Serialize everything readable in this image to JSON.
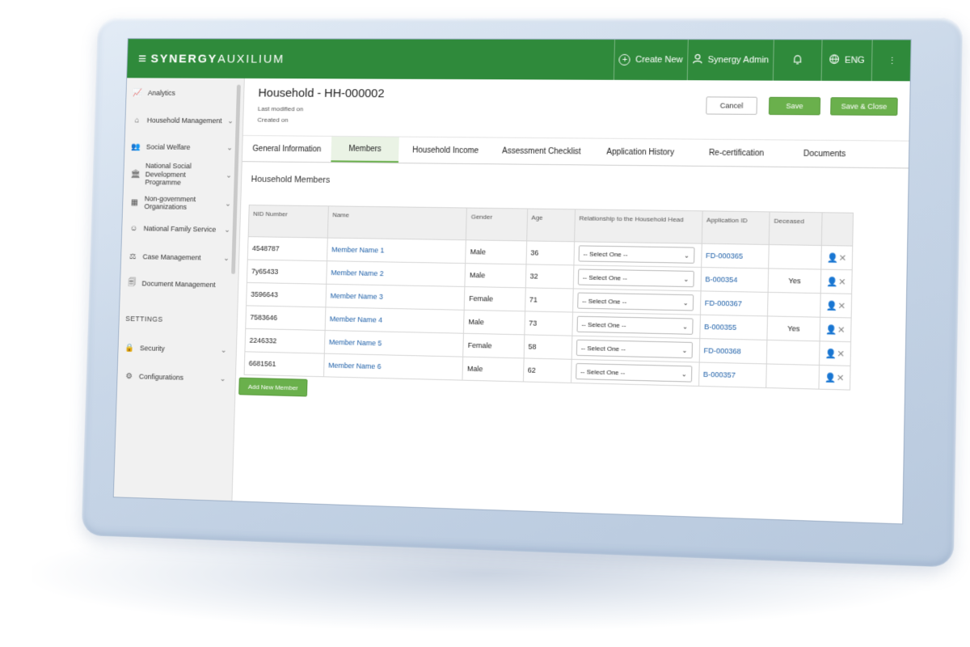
{
  "app": {
    "brand_strong": "SYNERGY",
    "brand_light": "AUXILIUM"
  },
  "topbar": {
    "create_new": "Create New",
    "user": "Synergy Admin",
    "language": "ENG"
  },
  "sidebar": {
    "items": [
      {
        "label": "Analytics",
        "icon": "chart-icon",
        "has_chevron": false
      },
      {
        "label": "Household Management",
        "icon": "home-icon",
        "has_chevron": true
      },
      {
        "label": "Social Welfare",
        "icon": "people-icon",
        "has_chevron": true
      },
      {
        "label": "National Social Development Programme",
        "icon": "bank-icon",
        "has_chevron": true
      },
      {
        "label": "Non-government Organizations",
        "icon": "building-icon",
        "has_chevron": true
      },
      {
        "label": "National Family Service",
        "icon": "family-icon",
        "has_chevron": true
      },
      {
        "label": "Case Management",
        "icon": "scale-icon",
        "has_chevron": true
      },
      {
        "label": "Document Management",
        "icon": "document-icon",
        "has_chevron": false
      }
    ],
    "settings_heading": "SETTINGS",
    "settings_items": [
      {
        "label": "Security",
        "icon": "lock-icon"
      },
      {
        "label": "Configurations",
        "icon": "gear-icon"
      }
    ]
  },
  "page": {
    "title": "Household - HH-000002",
    "last_modified": "Last modified on",
    "created": "Created on",
    "cancel": "Cancel",
    "save": "Save",
    "save_close": "Save & Close"
  },
  "tabs": [
    {
      "label": "General Information",
      "active": false
    },
    {
      "label": "Members",
      "active": true
    },
    {
      "label": "Household Income",
      "active": false
    },
    {
      "label": "Assessment Checklist",
      "active": false
    },
    {
      "label": "Application History",
      "active": false
    },
    {
      "label": "Re-certification",
      "active": false
    },
    {
      "label": "Documents",
      "active": false
    }
  ],
  "members": {
    "section_title": "Household Members",
    "columns": [
      "NID Number",
      "Name",
      "Gender",
      "Age",
      "Relationship to the Household Head",
      "Application ID",
      "Deceased",
      ""
    ],
    "select_placeholder": "-- Select One --",
    "rows": [
      {
        "nid": "4548787",
        "name": "Member Name 1",
        "gender": "Male",
        "age": "36",
        "app_id": "FD-000365",
        "deceased": ""
      },
      {
        "nid": "7y65433",
        "name": "Member Name 2",
        "gender": "Male",
        "age": "32",
        "app_id": "B-000354",
        "deceased": "Yes"
      },
      {
        "nid": "3596643",
        "name": "Member Name 3",
        "gender": "Female",
        "age": "71",
        "app_id": "FD-000367",
        "deceased": ""
      },
      {
        "nid": "7583646",
        "name": "Member Name 4",
        "gender": "Male",
        "age": "73",
        "app_id": "B-000355",
        "deceased": "Yes"
      },
      {
        "nid": "2246332",
        "name": "Member Name 5",
        "gender": "Female",
        "age": "58",
        "app_id": "FD-000368",
        "deceased": ""
      },
      {
        "nid": "6681561",
        "name": "Member Name 6",
        "gender": "Male",
        "age": "62",
        "app_id": "B-000357",
        "deceased": ""
      }
    ],
    "add_button": "Add New Member"
  }
}
